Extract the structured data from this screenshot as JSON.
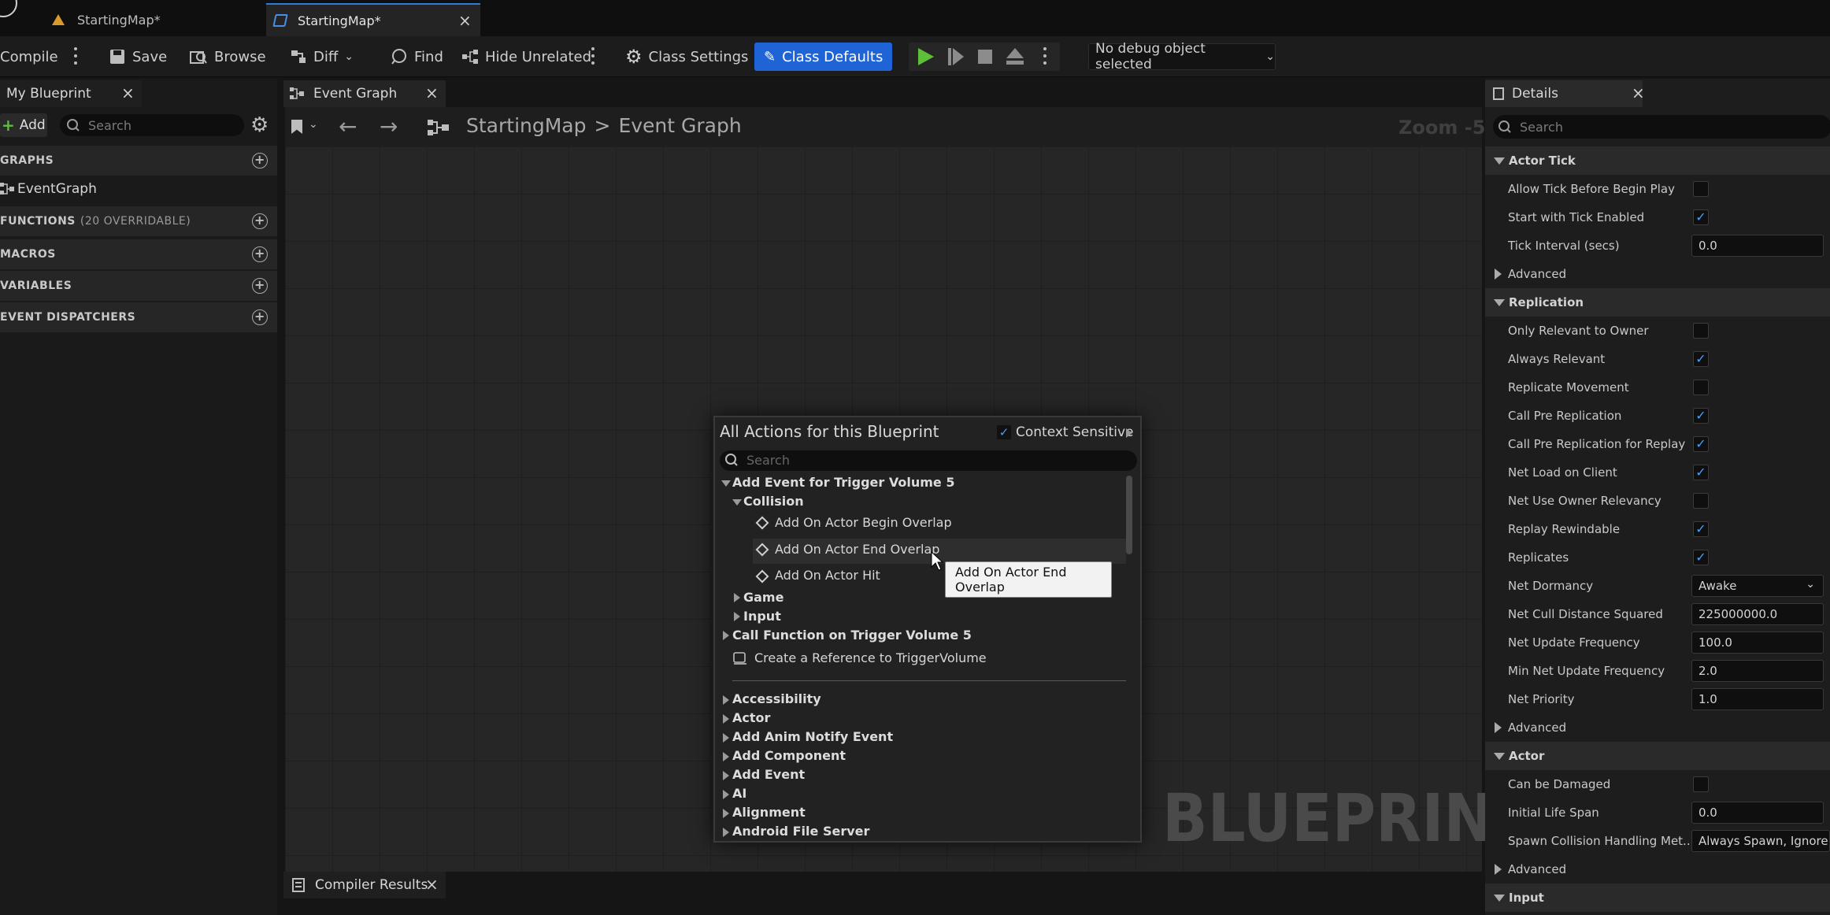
{
  "tabs": [
    {
      "label": "StartingMap*"
    },
    {
      "label": "StartingMap*"
    }
  ],
  "toolbar": {
    "compile": "Compile",
    "save": "Save",
    "browse": "Browse",
    "diff": "Diff",
    "find": "Find",
    "hide_unrelated": "Hide Unrelated",
    "class_settings": "Class Settings",
    "class_defaults": "Class Defaults",
    "debug": "No debug object selected"
  },
  "my_blueprint": {
    "title": "My Blueprint",
    "add": "Add",
    "search_placeholder": "Search",
    "graphs": "GRAPHS",
    "event_graph": "EventGraph",
    "functions": "FUNCTIONS",
    "functions_count": "(20 OVERRIDABLE)",
    "macros": "MACROS",
    "variables": "VARIABLES",
    "event_dispatchers": "EVENT DISPATCHERS"
  },
  "graph": {
    "tab": "Event Graph",
    "breadcrumb_root": "StartingMap",
    "breadcrumb_sep": ">",
    "breadcrumb_current": "Event Graph",
    "zoom": "Zoom -5",
    "watermark": "BLUEPRINT"
  },
  "action_menu": {
    "title": "All Actions for this Blueprint",
    "context_sensitive": "Context Sensitive",
    "search_placeholder": "Search",
    "add_event_trigger": "Add Event for Trigger Volume 5",
    "collision": "Collision",
    "begin_overlap": "Add On Actor Begin Overlap",
    "end_overlap": "Add On Actor End Overlap",
    "actor_hit": "Add On Actor Hit",
    "game": "Game",
    "input": "Input",
    "call_function": "Call Function on Trigger Volume 5",
    "create_reference": "Create a Reference to TriggerVolume",
    "categories": [
      "Accessibility",
      "Actor",
      "Add Anim Notify Event",
      "Add Component",
      "Add Event",
      "AI",
      "Alignment",
      "Android File Server"
    ],
    "tooltip": "Add On Actor End Overlap"
  },
  "compiler_results": "Compiler Results",
  "details": {
    "title": "Details",
    "search_placeholder": "Search",
    "actor_tick": "Actor Tick",
    "allow_tick": "Allow Tick Before Begin Play",
    "start_tick": "Start with Tick Enabled",
    "tick_interval": "Tick Interval (secs)",
    "tick_interval_value": "0.0",
    "advanced": "Advanced",
    "replication": "Replication",
    "only_relevant": "Only Relevant to Owner",
    "always_relevant": "Always Relevant",
    "replicate_movement": "Replicate Movement",
    "call_pre_rep": "Call Pre Replication",
    "call_pre_rep_replay": "Call Pre Replication for Replay",
    "net_load": "Net Load on Client",
    "net_use_owner": "Net Use Owner Relevancy",
    "replay_rewindable": "Replay Rewindable",
    "replicates": "Replicates",
    "net_dormancy": "Net Dormancy",
    "net_dormancy_value": "Awake",
    "net_cull": "Net Cull Distance Squared",
    "net_cull_value": "225000000.0",
    "net_update": "Net Update Frequency",
    "net_update_value": "100.0",
    "min_net_update": "Min Net Update Frequency",
    "min_net_update_value": "2.0",
    "net_priority": "Net Priority",
    "net_priority_value": "1.0",
    "actor": "Actor",
    "can_be_damaged": "Can be Damaged",
    "initial_life": "Initial Life Span",
    "initial_life_value": "0.0",
    "spawn_collision": "Spawn Collision Handling Met...",
    "spawn_collision_value": "Always Spawn, Ignore Co",
    "input": "Input"
  },
  "checkbox_states": {
    "allow_tick": false,
    "start_tick": true,
    "only_relevant": false,
    "always_relevant": true,
    "replicate_movement": false,
    "call_pre_rep": true,
    "call_pre_rep_replay": true,
    "net_load": true,
    "net_use_owner": false,
    "replay_rewindable": true,
    "replicates": true,
    "can_be_damaged": false,
    "context_sensitive": true
  },
  "colors": {
    "accent_blue": "#1e64d6",
    "play_green": "#5fbf3a",
    "check_blue": "#4f9df5"
  }
}
